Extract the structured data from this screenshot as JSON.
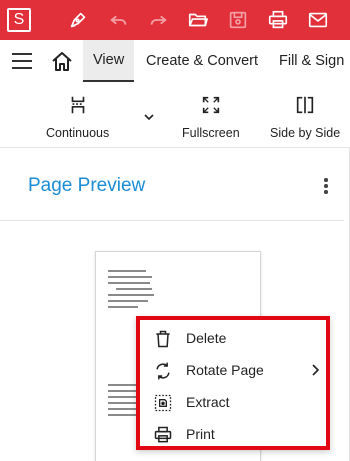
{
  "app": {
    "logo_letter": "S"
  },
  "titlebar": {
    "icons": [
      "pen-icon",
      "undo-icon",
      "redo-icon",
      "open-folder-icon",
      "save-icon",
      "print-icon",
      "mail-icon"
    ]
  },
  "tabs": [
    {
      "label": "View",
      "active": true
    },
    {
      "label": "Create & Convert",
      "active": false
    },
    {
      "label": "Fill & Sign",
      "active": false
    }
  ],
  "toolbar": {
    "continuous_label": "Continuous",
    "fullscreen_label": "Fullscreen",
    "side_by_side_label": "Side by Side"
  },
  "panel": {
    "title": "Page Preview"
  },
  "context_menu": {
    "items": [
      {
        "label": "Delete",
        "icon": "trash-icon"
      },
      {
        "label": "Rotate Page",
        "icon": "rotate-icon",
        "has_submenu": true
      },
      {
        "label": "Extract",
        "icon": "extract-icon"
      },
      {
        "label": "Print",
        "icon": "print-icon"
      }
    ]
  },
  "colors": {
    "titlebar": "#e2303b",
    "accent_title": "#1a8dd6",
    "menu_highlight_border": "#e30613"
  }
}
